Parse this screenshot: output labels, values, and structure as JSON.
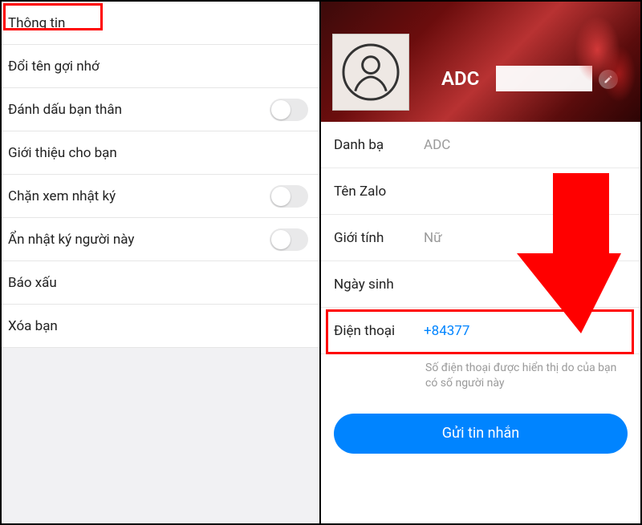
{
  "left": {
    "items": [
      {
        "label": "Thông tin",
        "toggle": false
      },
      {
        "label": "Đổi tên gợi nhớ",
        "toggle": false
      },
      {
        "label": "Đánh dấu bạn thân",
        "toggle": true
      },
      {
        "label": "Giới thiệu cho bạn",
        "toggle": false
      },
      {
        "label": "Chặn xem nhật ký",
        "toggle": true
      },
      {
        "label": "Ẩn nhật ký người này",
        "toggle": true
      },
      {
        "label": "Báo xấu",
        "toggle": false
      },
      {
        "label": "Xóa bạn",
        "toggle": false
      }
    ]
  },
  "right": {
    "display_name": "ADC",
    "fields": {
      "contact_label": "Danh bạ",
      "contact_value": "ADC",
      "zalo_label": "Tên Zalo",
      "zalo_value": "",
      "gender_label": "Giới tính",
      "gender_value": "Nữ",
      "dob_label": "Ngày sinh",
      "dob_value": "",
      "phone_label": "Điện thoại",
      "phone_value": "+84377"
    },
    "phone_hint": "Số điện thoại được hiển thị do của bạn có số người này",
    "send_button": "Gửi tin nhắn"
  }
}
